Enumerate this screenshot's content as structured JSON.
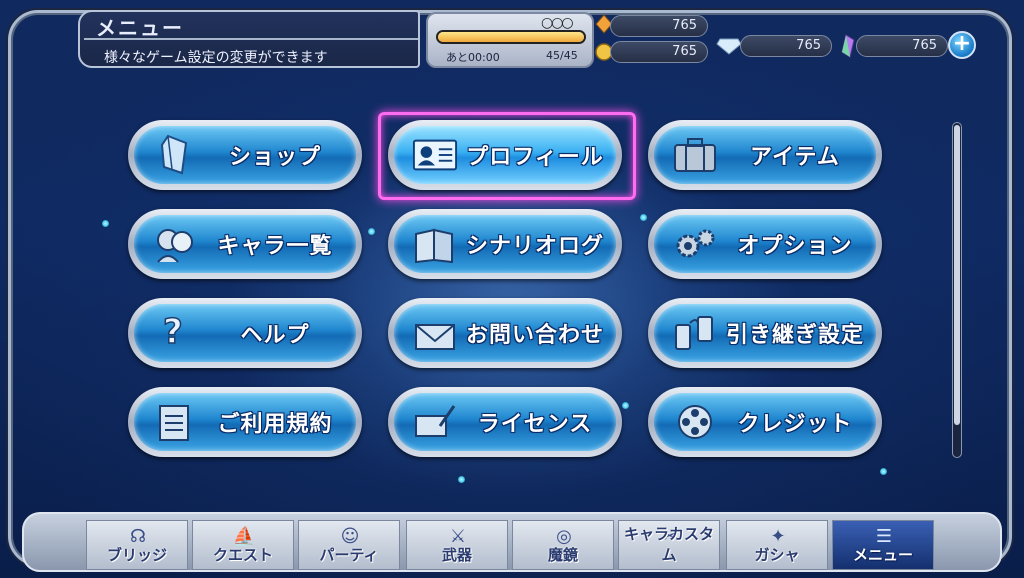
{
  "header": {
    "title": "メニュー",
    "subtitle": "様々なゲーム設定の変更ができます"
  },
  "status": {
    "stamina_circles": "○○○",
    "stamina_fraction": 1.0,
    "timer": "あと00:00",
    "stamina_count": "45/45",
    "currency_1": "765",
    "currency_2": "765",
    "currency_3": "765",
    "currency_4": "765",
    "plus_label": "+"
  },
  "menu": {
    "items": [
      {
        "label": "ショップ",
        "icon": "crystal-icon"
      },
      {
        "label": "プロフィール",
        "icon": "profile-card-icon",
        "selected": true
      },
      {
        "label": "アイテム",
        "icon": "suitcase-icon"
      },
      {
        "label": "キャラ一覧",
        "icon": "characters-icon"
      },
      {
        "label": "シナリオログ",
        "icon": "book-icon"
      },
      {
        "label": "オプション",
        "icon": "gear-icon"
      },
      {
        "label": "ヘルプ",
        "icon": "question-icon"
      },
      {
        "label": "お問い合わせ",
        "icon": "envelope-icon"
      },
      {
        "label": "引き継ぎ設定",
        "icon": "phones-icon"
      },
      {
        "label": "ご利用規約",
        "icon": "document-icon"
      },
      {
        "label": "ライセンス",
        "icon": "pen-icon"
      },
      {
        "label": "クレジット",
        "icon": "film-reel-icon"
      }
    ]
  },
  "nav": {
    "tabs": [
      {
        "label": "ブリッジ",
        "icon": "bridge-icon"
      },
      {
        "label": "クエスト",
        "icon": "ship-icon"
      },
      {
        "label": "パーティ",
        "icon": "party-icon"
      },
      {
        "label": "武器",
        "icon": "sword-icon"
      },
      {
        "label": "魔鏡",
        "icon": "mirror-icon"
      },
      {
        "label": "キャラカスタム",
        "icon": "custom-icon"
      },
      {
        "label": "ガシャ",
        "icon": "gacha-icon"
      },
      {
        "label": "メニュー",
        "icon": "menu-icon",
        "active": true
      }
    ]
  }
}
